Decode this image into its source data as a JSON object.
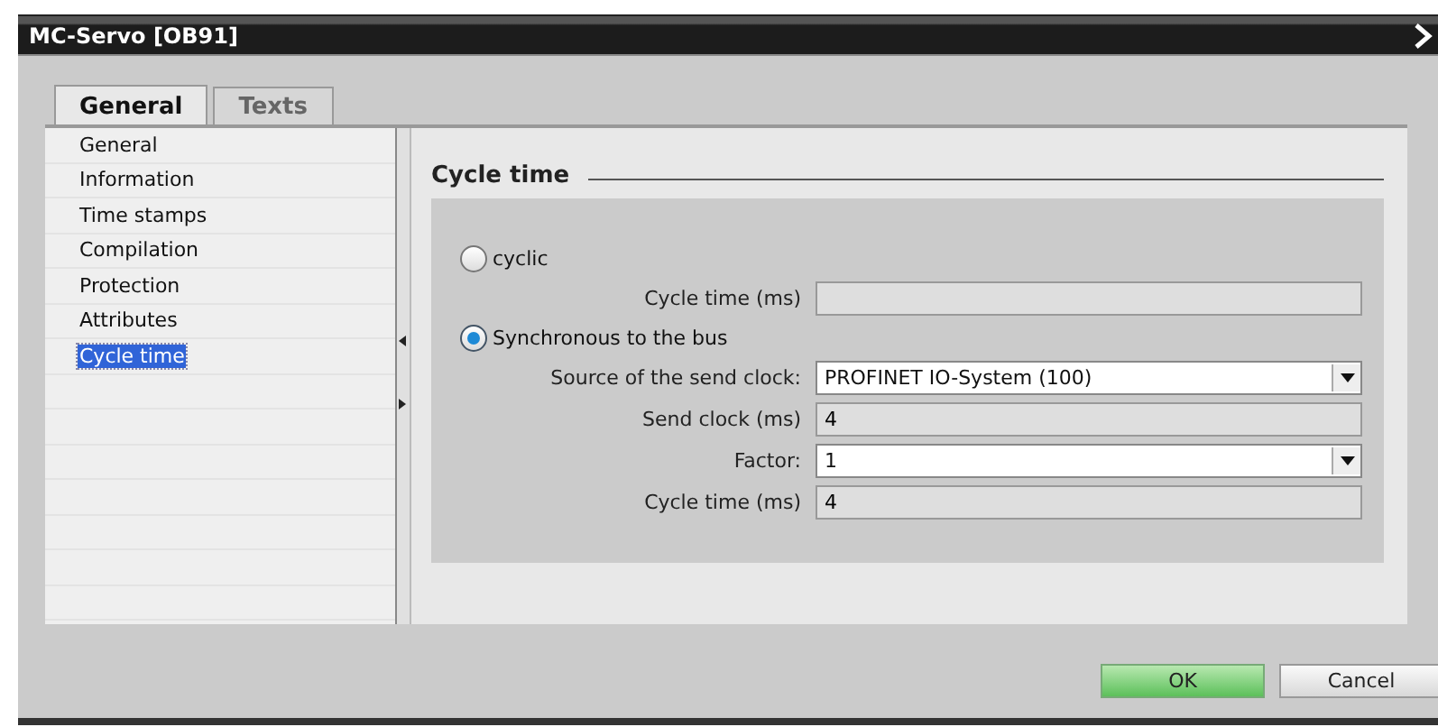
{
  "window": {
    "title": "MC-Servo [OB91]"
  },
  "tabs": [
    {
      "label": "General",
      "selected": true
    },
    {
      "label": "Texts",
      "selected": false
    }
  ],
  "sidebar": {
    "items": [
      {
        "label": "General",
        "selected": false
      },
      {
        "label": "Information",
        "selected": false
      },
      {
        "label": "Time stamps",
        "selected": false
      },
      {
        "label": "Compilation",
        "selected": false
      },
      {
        "label": "Protection",
        "selected": false
      },
      {
        "label": "Attributes",
        "selected": false
      },
      {
        "label": "Cycle time",
        "selected": true
      }
    ]
  },
  "section": {
    "title": "Cycle time"
  },
  "options": [
    {
      "label": "cyclic",
      "selected": false,
      "fields": [
        {
          "kind": "text",
          "label": "Cycle time (ms)"
        }
      ]
    },
    {
      "label": "Synchronous to the bus",
      "selected": true,
      "fields": [
        {
          "kind": "dropdown",
          "label": "Source of the send clock:",
          "value": "PROFINET IO-System (100)"
        },
        {
          "kind": "text",
          "label": "Send clock (ms)",
          "value": "4"
        },
        {
          "kind": "dropdown",
          "label": "Factor:",
          "value": "1"
        },
        {
          "kind": "text",
          "label": "Cycle time (ms)",
          "value": "4"
        }
      ]
    }
  ],
  "buttons": [
    {
      "label": "OK",
      "primary": true
    },
    {
      "label": "Cancel",
      "primary": false
    }
  ]
}
